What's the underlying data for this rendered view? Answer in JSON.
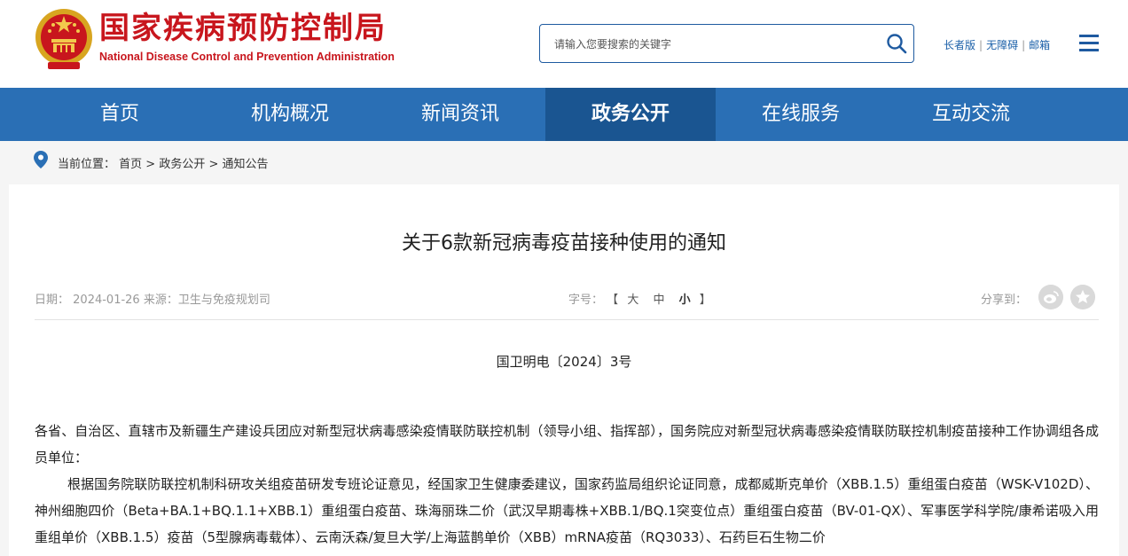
{
  "header": {
    "org_name_cn": "国家疾病预防控制局",
    "org_name_en": "National Disease Control and Prevention Administration",
    "search_placeholder": "请输入您要搜索的关键字",
    "links": [
      "长者版",
      "无障碍",
      "邮箱"
    ]
  },
  "nav": {
    "items": [
      "首页",
      "机构概况",
      "新闻资讯",
      "政务公开",
      "在线服务",
      "互动交流"
    ],
    "active": "政务公开"
  },
  "breadcrumb": {
    "prefix": "当前位置：",
    "items": [
      "首页",
      "政务公开",
      "通知公告"
    ],
    "separator": " > "
  },
  "article": {
    "title": "关于6款新冠病毒疫苗接种使用的通知",
    "date_label": "日期：",
    "date": "2024-01-26",
    "source_label": "来源：",
    "source": "卫生与免疫规划司",
    "fontsize_label": "字号：",
    "fontsize_open": "【",
    "fontsize_options": [
      "大",
      "中",
      "小"
    ],
    "fontsize_close": "】",
    "share_label": "分享到：",
    "doc_number": "国卫明电〔2024〕3号",
    "paragraphs": [
      "各省、自治区、直辖市及新疆生产建设兵团应对新型冠状病毒感染疫情联防联控机制（领导小组、指挥部），国务院应对新型冠状病毒感染疫情联防联控机制疫苗接种工作协调组各成员单位：",
      "根据国务院联防联控机制科研攻关组疫苗研发专班论证意见，经国家卫生健康委建议，国家药监局组织论证同意，成都威斯克单价（XBB.1.5）重组蛋白疫苗（WSK-V102D）、神州细胞四价（Beta+BA.1+BQ.1.1+XBB.1）重组蛋白疫苗、珠海丽珠二价（武汉早期毒株+XBB.1/BQ.1突变位点）重组蛋白疫苗（BV-01-QX）、军事医学科学院/康希诺吸入用重组单价（XBB.1.5）疫苗（5型腺病毒载体）、云南沃森/复旦大学/上海蓝鹊单价（XBB）mRNA疫苗（RQ3033）、石药巨石生物二价"
    ]
  },
  "colors": {
    "brand_red": "#c8161d",
    "nav_blue": "#2a6fb5",
    "nav_active": "#1a5591",
    "link_blue": "#1a5fa8"
  },
  "icons": {
    "search": "search-icon",
    "menu": "menu-icon",
    "location": "location-pin-icon",
    "share": [
      "weibo-icon",
      "favorite-icon"
    ]
  }
}
